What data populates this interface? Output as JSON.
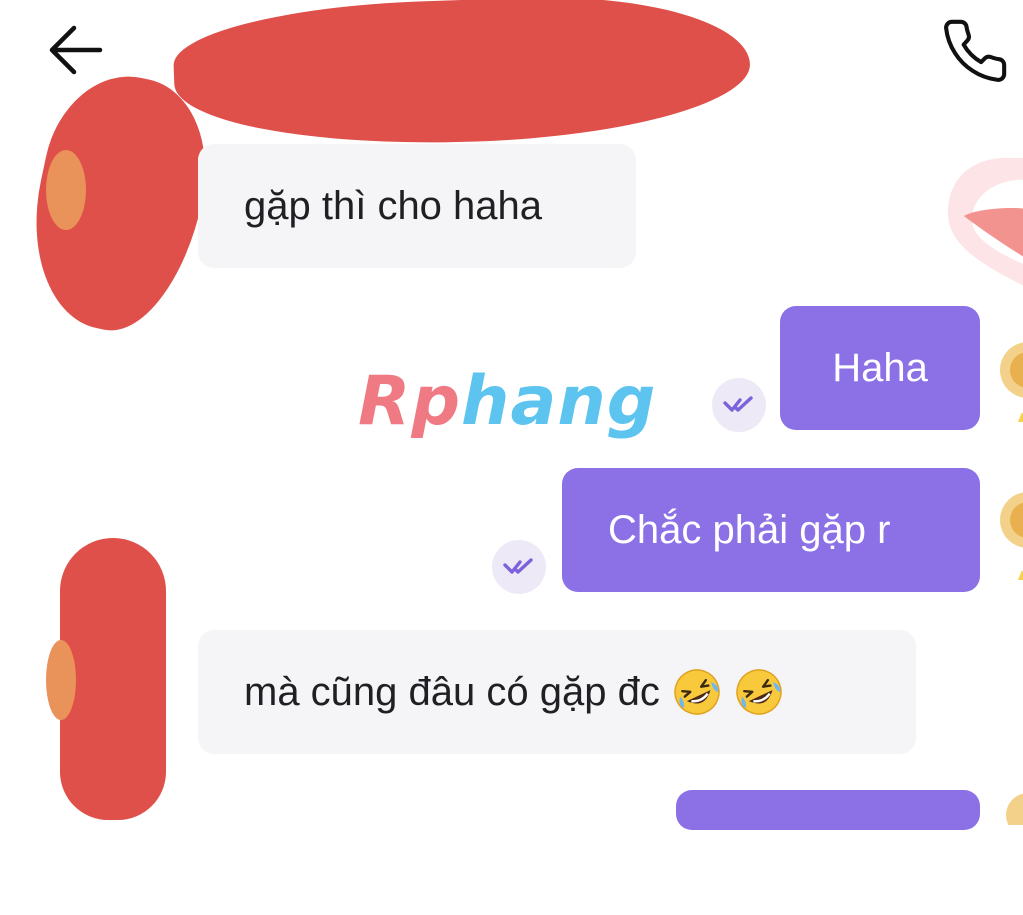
{
  "header": {
    "back_icon": "arrow-left-icon",
    "call_icon": "phone-icon"
  },
  "watermark": {
    "part1": "Rp",
    "part2": "hang"
  },
  "messages": [
    {
      "direction": "incoming",
      "text": "gặp thì cho haha"
    },
    {
      "direction": "outgoing",
      "text": "Haha",
      "status_icon": "double-check-icon"
    },
    {
      "direction": "outgoing",
      "text": "Chắc phải gặp r",
      "status_icon": "double-check-icon"
    },
    {
      "direction": "incoming",
      "text": "mà cũng đâu có gặp đc",
      "emoji": [
        "rolling-on-floor-laughing-icon",
        "rolling-on-floor-laughing-icon"
      ]
    },
    {
      "direction": "outgoing",
      "text": ""
    }
  ],
  "colors": {
    "outgoing_bubble": "#8b70e6",
    "incoming_bubble": "#f5f5f7",
    "read_mark_bg": "#ede9f7",
    "read_mark_icon": "#7e62dc",
    "redaction": "#e0504a"
  }
}
